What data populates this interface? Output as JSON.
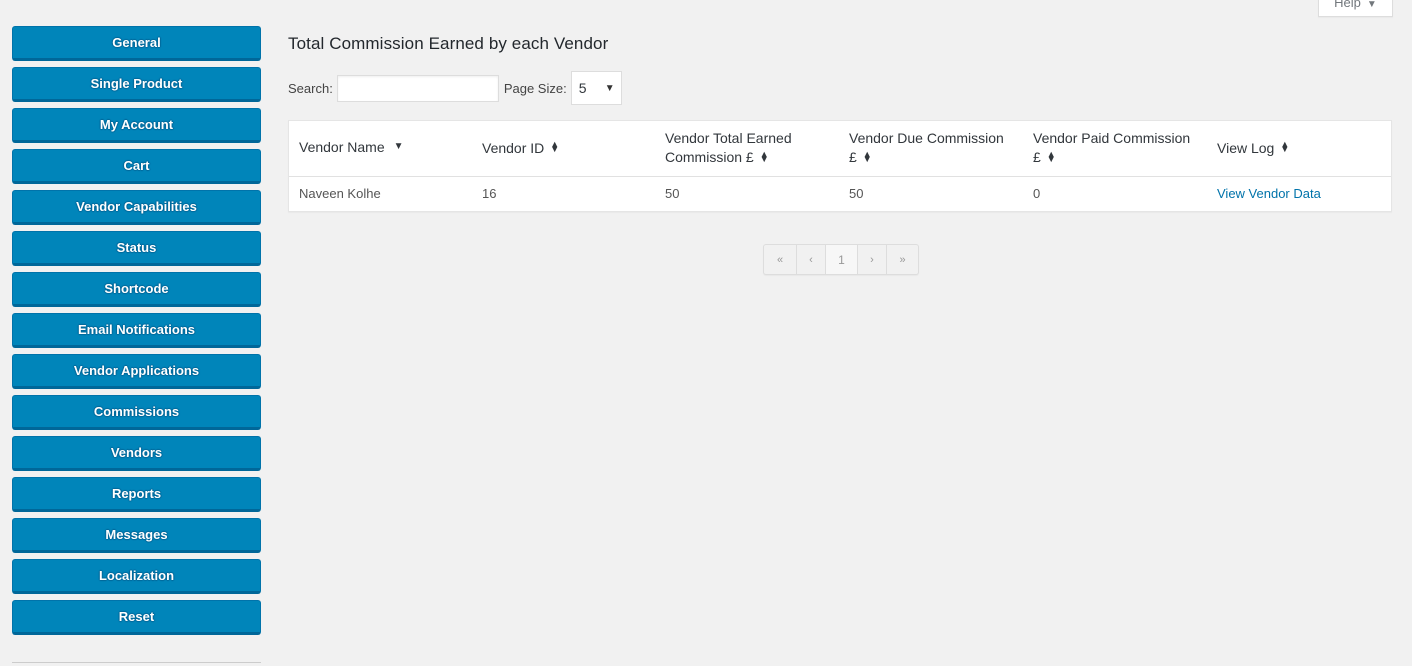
{
  "sidebar": {
    "items": [
      {
        "label": "General"
      },
      {
        "label": "Single Product"
      },
      {
        "label": "My Account"
      },
      {
        "label": "Cart"
      },
      {
        "label": "Vendor Capabilities"
      },
      {
        "label": "Status"
      },
      {
        "label": "Shortcode"
      },
      {
        "label": "Email Notifications"
      },
      {
        "label": "Vendor Applications"
      },
      {
        "label": "Commissions"
      },
      {
        "label": "Vendors"
      },
      {
        "label": "Reports"
      },
      {
        "label": "Messages"
      },
      {
        "label": "Localization"
      },
      {
        "label": "Reset"
      }
    ]
  },
  "help": {
    "label": "Help",
    "caret": "▼"
  },
  "main": {
    "title": "Total Commission Earned by each Vendor",
    "search": {
      "label": "Search:",
      "value": "",
      "placeholder": ""
    },
    "page_size": {
      "label": "Page Size:",
      "value": "5",
      "caret": "▼"
    },
    "table": {
      "columns": [
        {
          "line1": "Vendor Name",
          "line2": "",
          "sort": "desc"
        },
        {
          "line1": "Vendor ID",
          "line2": "",
          "sort": "both"
        },
        {
          "line1": "Vendor Total Earned",
          "line2": "Commission £",
          "sort": "both"
        },
        {
          "line1": "Vendor Due Commission",
          "line2": "£",
          "sort": "both"
        },
        {
          "line1": "Vendor Paid Commission",
          "line2": "£",
          "sort": "both"
        },
        {
          "line1": "View Log",
          "line2": "",
          "sort": "both"
        }
      ],
      "rows": [
        {
          "vendor_name": "Naveen Kolhe",
          "vendor_id": "16",
          "total_earned": "50",
          "due": "50",
          "paid": "0",
          "view_log": "View Vendor Data"
        }
      ]
    },
    "pagination": {
      "first": "«",
      "prev": "‹",
      "current": "1",
      "next": "›",
      "last": "»"
    }
  },
  "colors": {
    "nav_button": "#0085ba",
    "link": "#0073aa",
    "background": "#f1f1f1"
  }
}
